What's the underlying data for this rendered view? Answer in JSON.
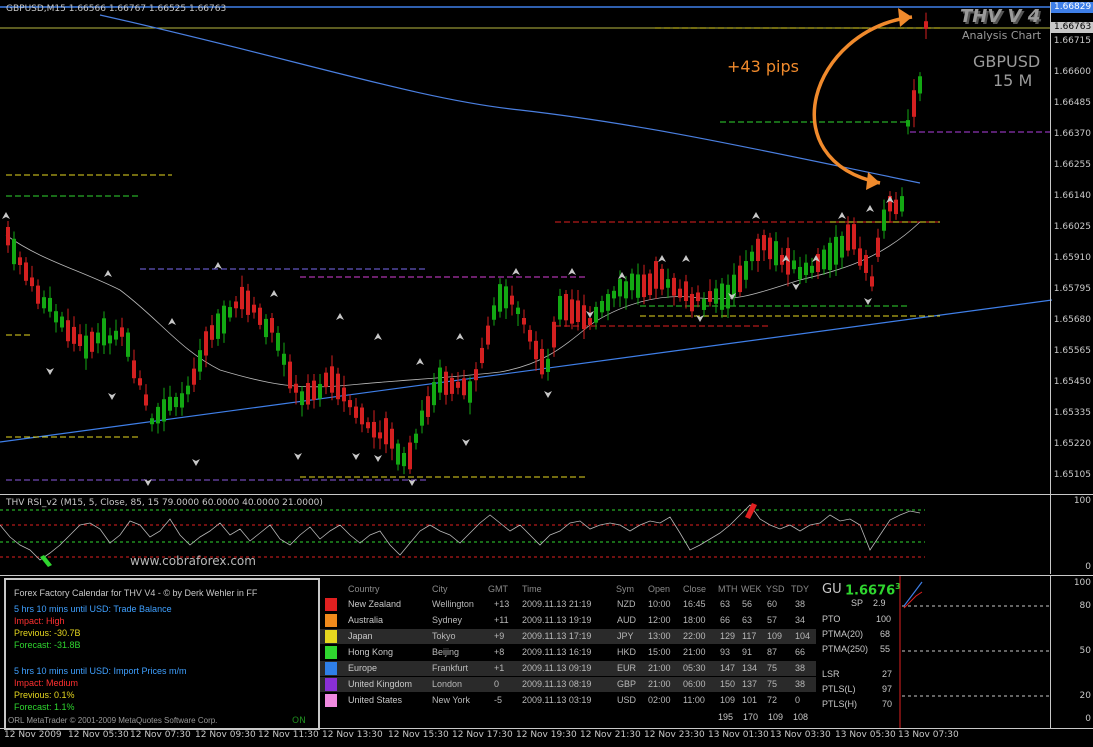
{
  "chart": {
    "symbol_header": "GBPUSD,M15  1.66566 1.66767 1.66525 1.66763",
    "brand_title": "THV V 4",
    "brand_subtitle": "Analysis Chart",
    "pair": "GBPUSD",
    "timeframe": "15 M",
    "annotation": "+43 pips",
    "watermark": "www.cobraforex.com",
    "copyright": "ORL MetaTrader © 2001-2009 MetaQuotes Software Corp.",
    "on_label": "ON",
    "price_axis": [
      "1.66829",
      "1.66763",
      "1.66715",
      "1.66600",
      "1.66485",
      "1.66370",
      "1.66255",
      "1.66140",
      "1.66025",
      "1.65910",
      "1.65795",
      "1.65680",
      "1.65565",
      "1.65450",
      "1.65335",
      "1.65220",
      "1.65105"
    ],
    "time_axis": [
      "12 Nov 2009",
      "12 Nov 05:30",
      "12 Nov 07:30",
      "12 Nov 09:30",
      "12 Nov 11:30",
      "12 Nov 13:30",
      "12 Nov 15:30",
      "12 Nov 17:30",
      "12 Nov 19:30",
      "12 Nov 21:30",
      "12 Nov 23:30",
      "13 Nov 01:30",
      "13 Nov 03:30",
      "13 Nov 05:30",
      "13 Nov 07:30"
    ],
    "colors": {
      "bull": "#13a813",
      "bear": "#d42020",
      "ma250": "#4a7fe0",
      "trend": "#3f7fe8",
      "annotation": "#f08a2c"
    }
  },
  "rsi": {
    "header": "THV RSI_v2  (M15, 5, Close, 85, 15 79.0000 60.0000 40.0000 21.0000)",
    "axis": [
      "100",
      "0"
    ]
  },
  "calendar": {
    "title": "Forex Factory Calendar for THV V4 - © by Derk Wehler in FF",
    "event1": {
      "when": "5 hrs 10 mins until USD: Trade Balance",
      "impact": "Impact: High",
      "previous": "Previous: -30.7B",
      "forecast": "Forecast: -31.8B"
    },
    "event2": {
      "when": "5 hrs 10 mins until USD: Import Prices m/m",
      "impact": "Impact: Medium",
      "previous": "Previous: 0.1%",
      "forecast": "Forecast: 1.1%"
    }
  },
  "sessions": {
    "headers": [
      "Country",
      "City",
      "GMT",
      "Time",
      "Sym",
      "Open",
      "Close",
      "MTH",
      "WEK",
      "YSD",
      "TDY"
    ],
    "rows": [
      {
        "color": "#e02020",
        "country": "New Zealand",
        "city": "Wellington",
        "gmt": "+13",
        "time": "2009.11.13 21:19",
        "sym": "NZD",
        "open": "10:00",
        "close": "16:45",
        "mth": "63",
        "wek": "56",
        "ysd": "60",
        "tdy": "38"
      },
      {
        "color": "#f08a1c",
        "country": "Australia",
        "city": "Sydney",
        "gmt": "+11",
        "time": "2009.11.13 19:19",
        "sym": "AUD",
        "open": "12:00",
        "close": "18:00",
        "mth": "66",
        "wek": "63",
        "ysd": "57",
        "tdy": "34"
      },
      {
        "color": "#e6d71f",
        "country": "Japan",
        "city": "Tokyo",
        "gmt": "+9",
        "time": "2009.11.13 17:19",
        "sym": "JPY",
        "open": "13:00",
        "close": "22:00",
        "mth": "129",
        "wek": "117",
        "ysd": "109",
        "tdy": "104"
      },
      {
        "color": "#2fd62f",
        "country": "Hong Kong",
        "city": "Beijing",
        "gmt": "+8",
        "time": "2009.11.13 16:19",
        "sym": "HKD",
        "open": "15:00",
        "close": "21:00",
        "mth": "93",
        "wek": "91",
        "ysd": "87",
        "tdy": "66"
      },
      {
        "color": "#2f7fe8",
        "country": "Europe",
        "city": "Frankfurt",
        "gmt": "+1",
        "time": "2009.11.13 09:19",
        "sym": "EUR",
        "open": "21:00",
        "close": "05:30",
        "mth": "147",
        "wek": "134",
        "ysd": "75",
        "tdy": "38"
      },
      {
        "color": "#8a2fd6",
        "country": "United Kingdom",
        "city": "London",
        "gmt": "0",
        "time": "2009.11.13 08:19",
        "sym": "GBP",
        "open": "21:00",
        "close": "06:00",
        "mth": "150",
        "wek": "137",
        "ysd": "75",
        "tdy": "38"
      },
      {
        "color": "#f08ae0",
        "country": "United States",
        "city": "New York",
        "gmt": "-5",
        "time": "2009.11.13 03:19",
        "sym": "USD",
        "open": "02:00",
        "close": "11:00",
        "mth": "109",
        "wek": "101",
        "ysd": "72",
        "tdy": "0"
      }
    ],
    "totals": {
      "mth": "195",
      "wek": "170",
      "ysd": "109",
      "tdy": "108"
    }
  },
  "gu_panel": {
    "sym": "GU",
    "price": "1.6676",
    "price_sup": "3",
    "sp_label": "SP",
    "sp": "2.9",
    "pto_label": "PTO",
    "pto": "100",
    "ptma20_label": "PTMA(20)",
    "ptma20": "68",
    "ptma250_label": "PTMA(250)",
    "ptma250": "55",
    "lsr_label": "LSR",
    "lsr": "27",
    "ptlsl_label": "PTLS(L)",
    "ptlsl": "97",
    "ptlsh_label": "PTLS(H)",
    "ptlsh": "70"
  },
  "ind_axis": [
    "100",
    "80",
    "50",
    "20",
    "0"
  ]
}
